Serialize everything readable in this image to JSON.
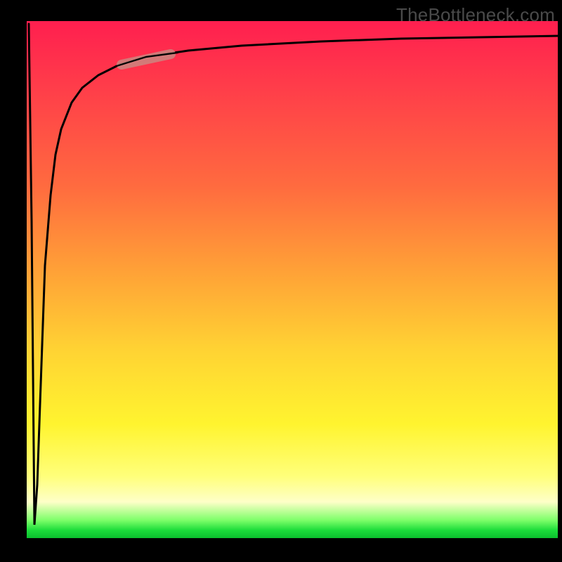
{
  "watermark": "TheBottleneck.com",
  "colors": {
    "background": "#000000",
    "gradient_top": "#ff1f4f",
    "gradient_mid1": "#ffa037",
    "gradient_mid2": "#fff42f",
    "gradient_bottom": "#0bbf2e",
    "curve_stroke": "#000000",
    "highlight_stroke": "#c98a82"
  },
  "chart_data": {
    "type": "line",
    "title": "",
    "xlabel": "",
    "ylabel": "",
    "xlim": [
      0,
      100
    ],
    "ylim": [
      0,
      100
    ],
    "grid": false,
    "legend": false,
    "series": [
      {
        "name": "bottleneck-curve",
        "x": [
          0,
          0.5,
          1,
          1.5,
          2,
          3,
          4,
          5,
          6,
          8,
          10,
          13,
          17,
          22,
          30,
          40,
          55,
          70,
          85,
          100
        ],
        "y": [
          99,
          60,
          25,
          10,
          25,
          52,
          66,
          74,
          79,
          84,
          87,
          89.5,
          91.5,
          93,
          94.3,
          95.2,
          96,
          96.5,
          96.8,
          97
        ]
      }
    ],
    "annotations": [
      {
        "name": "highlight-segment",
        "x_range": [
          17,
          27
        ],
        "approx_y": 92
      }
    ]
  }
}
